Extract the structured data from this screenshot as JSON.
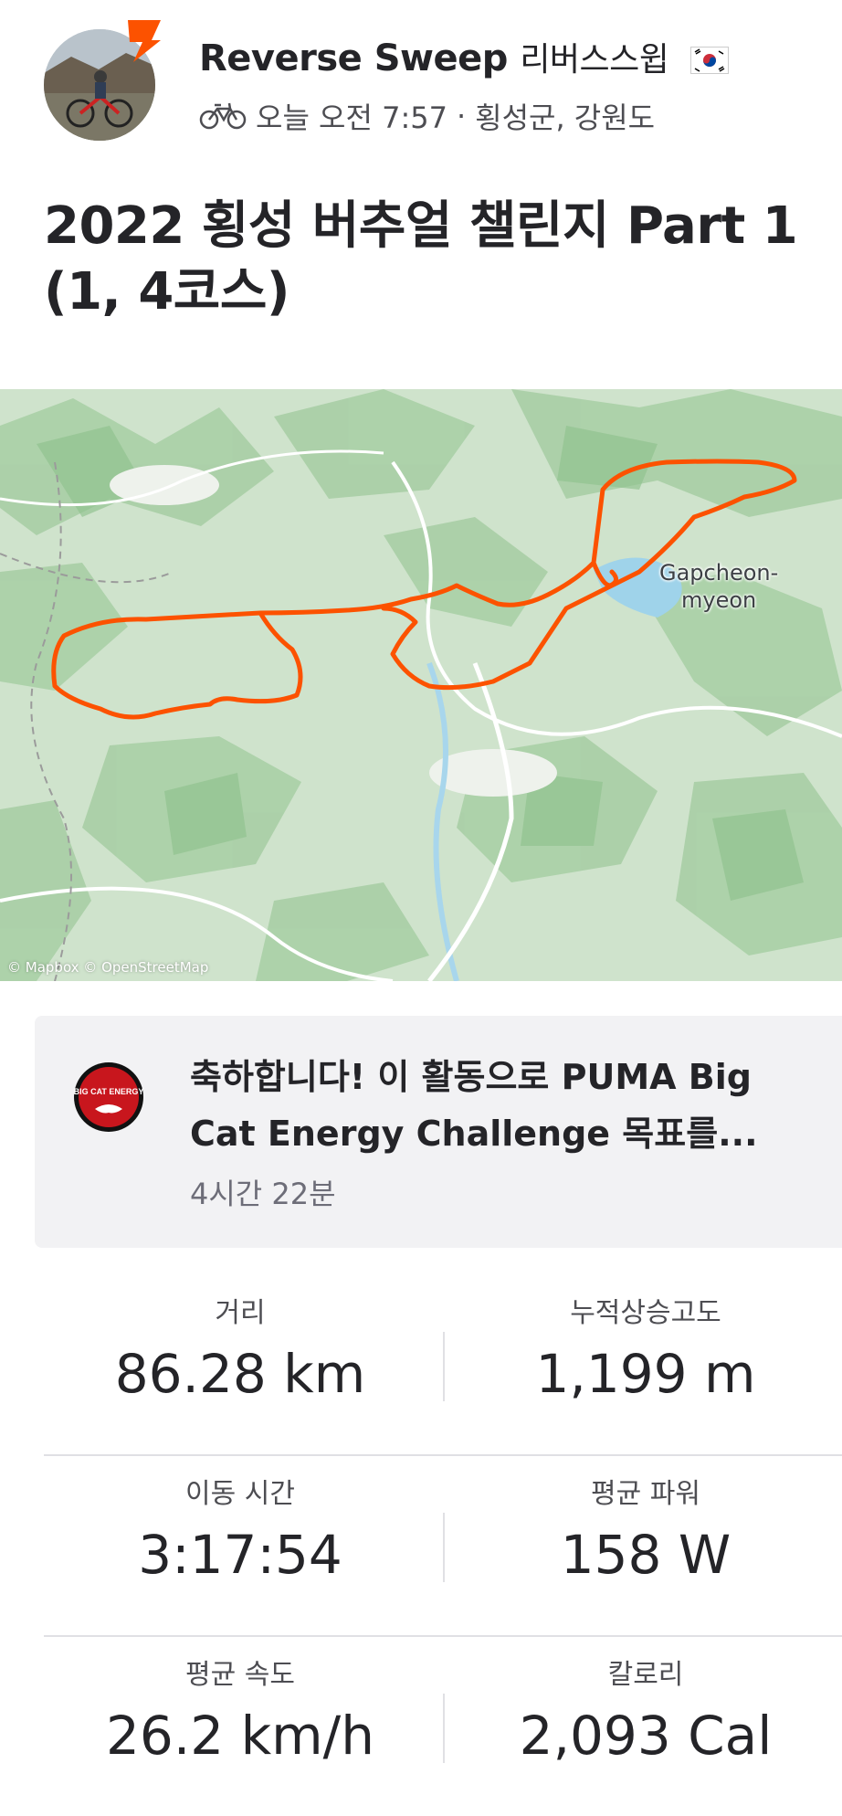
{
  "header": {
    "athlete_name": "Reverse Sweep",
    "athlete_name_ko": "리버스스윕",
    "activity_time": "오늘 오전 7:57",
    "separator": "·",
    "location": "횡성군, 강원도"
  },
  "activity": {
    "title": "2022 횡성 버추얼 챌린지 Part 1 (1, 4코스)"
  },
  "map": {
    "place_label_line1": "Gapcheon-",
    "place_label_line2": "myeon",
    "attribution": "© Mapbox © OpenStreetMap",
    "route_color": "#fc5200"
  },
  "achievement": {
    "message": "축하합니다! 이 활동으로 PUMA Big Cat Energy Challenge 목표를...",
    "duration": "4시간 22분",
    "badge_text": "BIG CAT ENERGY"
  },
  "stats": [
    {
      "left_label": "거리",
      "left_value": "86.28 km",
      "right_label": "누적상승고도",
      "right_value": "1,199 m"
    },
    {
      "left_label": "이동 시간",
      "left_value": "3:17:54",
      "right_label": "평균 파워",
      "right_value": "158 W"
    },
    {
      "left_label": "평균 속도",
      "left_value": "26.2 km/h",
      "right_label": "칼로리",
      "right_value": "2,093 Cal"
    }
  ],
  "colors": {
    "brand_orange": "#fc5200",
    "text_primary": "#242428",
    "text_secondary": "#6d6d78",
    "card_bg": "#f2f2f4"
  }
}
